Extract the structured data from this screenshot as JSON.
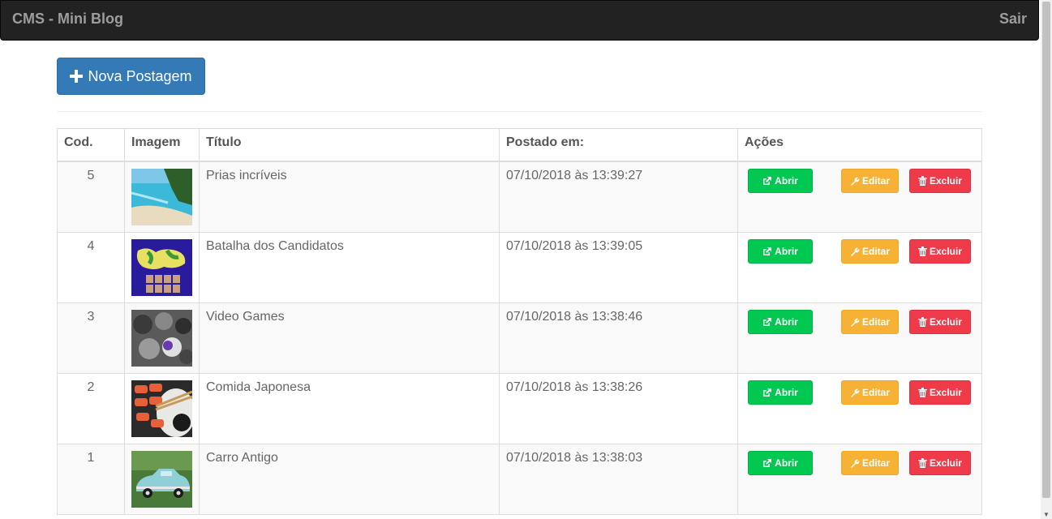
{
  "navbar": {
    "brand": "CMS - Mini Blog",
    "logout": "Sair"
  },
  "new_post_label": "Nova Postagem",
  "table": {
    "headers": {
      "code": "Cod.",
      "image": "Imagem",
      "title": "Título",
      "posted": "Postado em:",
      "actions": "Ações"
    },
    "rows": [
      {
        "code": "5",
        "title": "Prias incríveis",
        "posted": "07/10/2018 às 13:39:27",
        "image": "beach-photo"
      },
      {
        "code": "4",
        "title": "Batalha dos Candidatos",
        "posted": "07/10/2018 às 13:39:05",
        "image": "player-select-screen"
      },
      {
        "code": "3",
        "title": "Video Games",
        "posted": "07/10/2018 às 13:38:46",
        "image": "game-characters-collage"
      },
      {
        "code": "2",
        "title": "Comida Japonesa",
        "posted": "07/10/2018 às 13:38:26",
        "image": "sushi-plate"
      },
      {
        "code": "1",
        "title": "Carro Antigo",
        "posted": "07/10/2018 às 13:38:03",
        "image": "vintage-car"
      }
    ],
    "actions": {
      "open": "Abrir",
      "edit": "Editar",
      "delete": "Excluir"
    }
  },
  "colors": {
    "navbar": "#222222",
    "primary": "#337ab7",
    "open": "#00c851",
    "edit": "#f7b135",
    "delete": "#ef3a4a"
  },
  "icons": [
    "plus-icon",
    "external-link-icon",
    "wrench-icon",
    "trash-icon"
  ]
}
